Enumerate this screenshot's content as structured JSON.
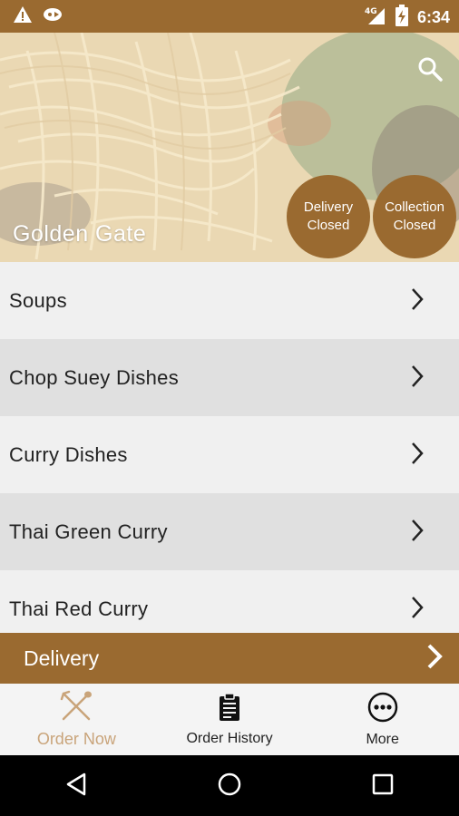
{
  "status_bar": {
    "time": "6:34",
    "network": "4G",
    "icons": [
      "warning-icon",
      "cast-icon",
      "signal-icon",
      "battery-charging-icon"
    ]
  },
  "hero": {
    "restaurant_name": "Golden Gate",
    "delivery_badge": {
      "line1": "Delivery",
      "line2": "Closed"
    },
    "collection_badge": {
      "line1": "Collection",
      "line2": "Closed"
    }
  },
  "menu": {
    "items": [
      {
        "label": "Soups"
      },
      {
        "label": "Chop Suey Dishes"
      },
      {
        "label": "Curry Dishes"
      },
      {
        "label": "Thai Green Curry"
      },
      {
        "label": "Thai Red Curry"
      }
    ]
  },
  "delivery_bar": {
    "label": "Delivery"
  },
  "tabs": [
    {
      "label": "Order Now",
      "icon": "fork-spoon-icon",
      "active": true
    },
    {
      "label": "Order History",
      "icon": "clipboard-icon",
      "active": false
    },
    {
      "label": "More",
      "icon": "more-dots-icon",
      "active": false
    }
  ],
  "colors": {
    "brand": "#9a6a30",
    "active_tab": "#c9a47a",
    "row_light": "#f0f0f0",
    "row_dark": "#e0e0e0"
  }
}
